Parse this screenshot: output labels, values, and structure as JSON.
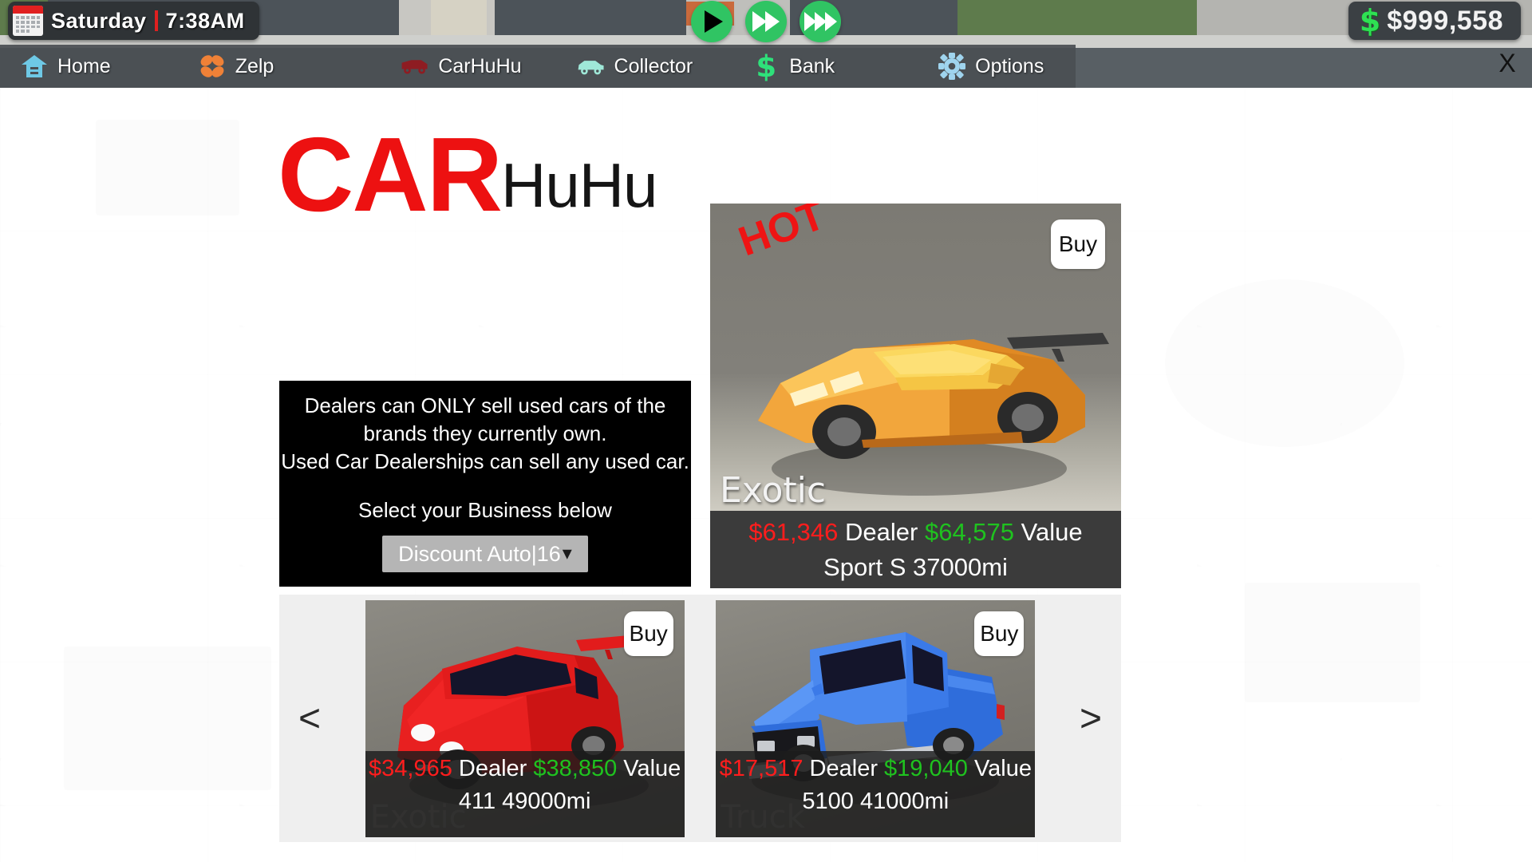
{
  "hud": {
    "calendar_icon": "calendar-icon",
    "day": "Saturday",
    "time": "7:38AM",
    "speed_buttons": [
      {
        "name": "play-button",
        "icon": "play-icon"
      },
      {
        "name": "fast-forward-2x-button",
        "icon": "double-forward-icon"
      },
      {
        "name": "fast-forward-3x-button",
        "icon": "triple-forward-icon"
      }
    ],
    "money_icon": "$",
    "money": "$999,558"
  },
  "nav": {
    "items": [
      {
        "label": "Home",
        "icon": "home-icon",
        "color": "#6ec9e6"
      },
      {
        "label": "Zelp",
        "icon": "flower-icon",
        "color": "#ef8137"
      },
      {
        "label": "CarHuHu",
        "icon": "van-icon",
        "color": "#8e1c22"
      },
      {
        "label": "Collector",
        "icon": "car-icon",
        "color": "#9fe8d8"
      },
      {
        "label": "Bank",
        "icon": "dollar-icon",
        "color": "#2ee07a"
      },
      {
        "label": "Options",
        "icon": "gear-icon",
        "color": "#9fd4ee"
      }
    ],
    "close_label": "X"
  },
  "logo": {
    "primary": "CAR",
    "primary_color": "#ed1111",
    "secondary": "HuHu",
    "secondary_color": "#151515"
  },
  "info_panel": {
    "lines": [
      "Dealers can ONLY sell used cars of the",
      "brands they currently own.",
      "Used Car Dealerships can sell any used car."
    ],
    "select_label": "Select your Business below",
    "business_selected": "Discount Auto|16",
    "chevron": "chevron-down-icon"
  },
  "featured_listing": {
    "badge": "HOT",
    "badge_color": "#ee1414",
    "buy_label": "Buy",
    "category": "Exotic",
    "dealer_price": "$61,346",
    "dealer_label": "Dealer",
    "value_price": "$64,575",
    "value_label": "Value",
    "model": "Sport S 37000mi",
    "car_color": "#f0a63a"
  },
  "gallery": {
    "prev_label": "<",
    "next_label": ">",
    "cards": [
      {
        "buy_label": "Buy",
        "category": "Exotic",
        "dealer_price": "$34,965",
        "dealer_label": "Dealer",
        "value_price": "$38,850",
        "value_label": "Value",
        "model": "411 49000mi",
        "car_color": "#e21c1c"
      },
      {
        "buy_label": "Buy",
        "category": "Truck",
        "dealer_price": "$17,517",
        "dealer_label": "Dealer",
        "value_price": "$19,040",
        "value_label": "Value",
        "model": "5100 41000mi",
        "car_color": "#2f6ddb"
      }
    ]
  },
  "colors": {
    "dealer_price": "#ff1d1d",
    "value_price": "#1fc21f",
    "panel_bg": "#ffffff",
    "nav_bg": "#4a4f53",
    "card_bg": "#3b3b3b"
  }
}
